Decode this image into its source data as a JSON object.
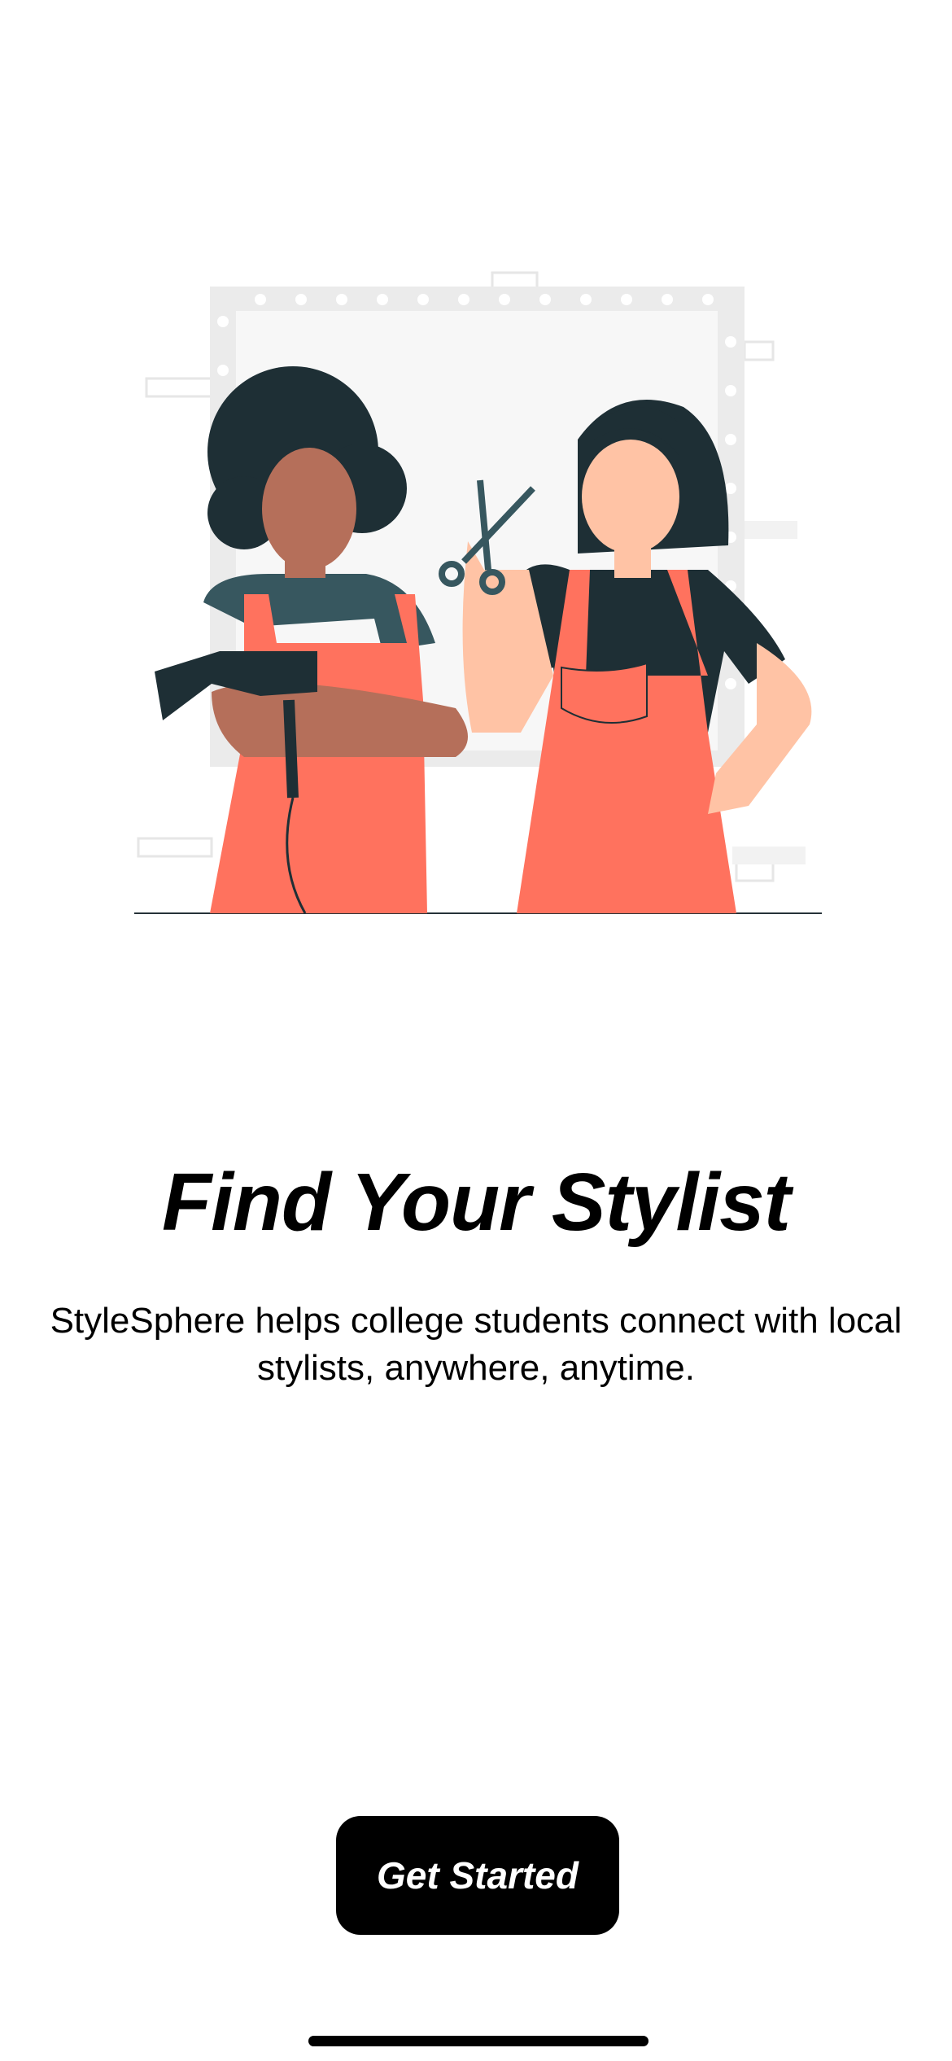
{
  "onboarding": {
    "title": "Find Your Stylist",
    "subtitle": "StyleSphere helps college students connect with local stylists, anywhere, anytime.",
    "cta_label": "Get Started"
  },
  "colors": {
    "accent": "#FF725E",
    "dark": "#1E2F35",
    "button": "#000000"
  }
}
